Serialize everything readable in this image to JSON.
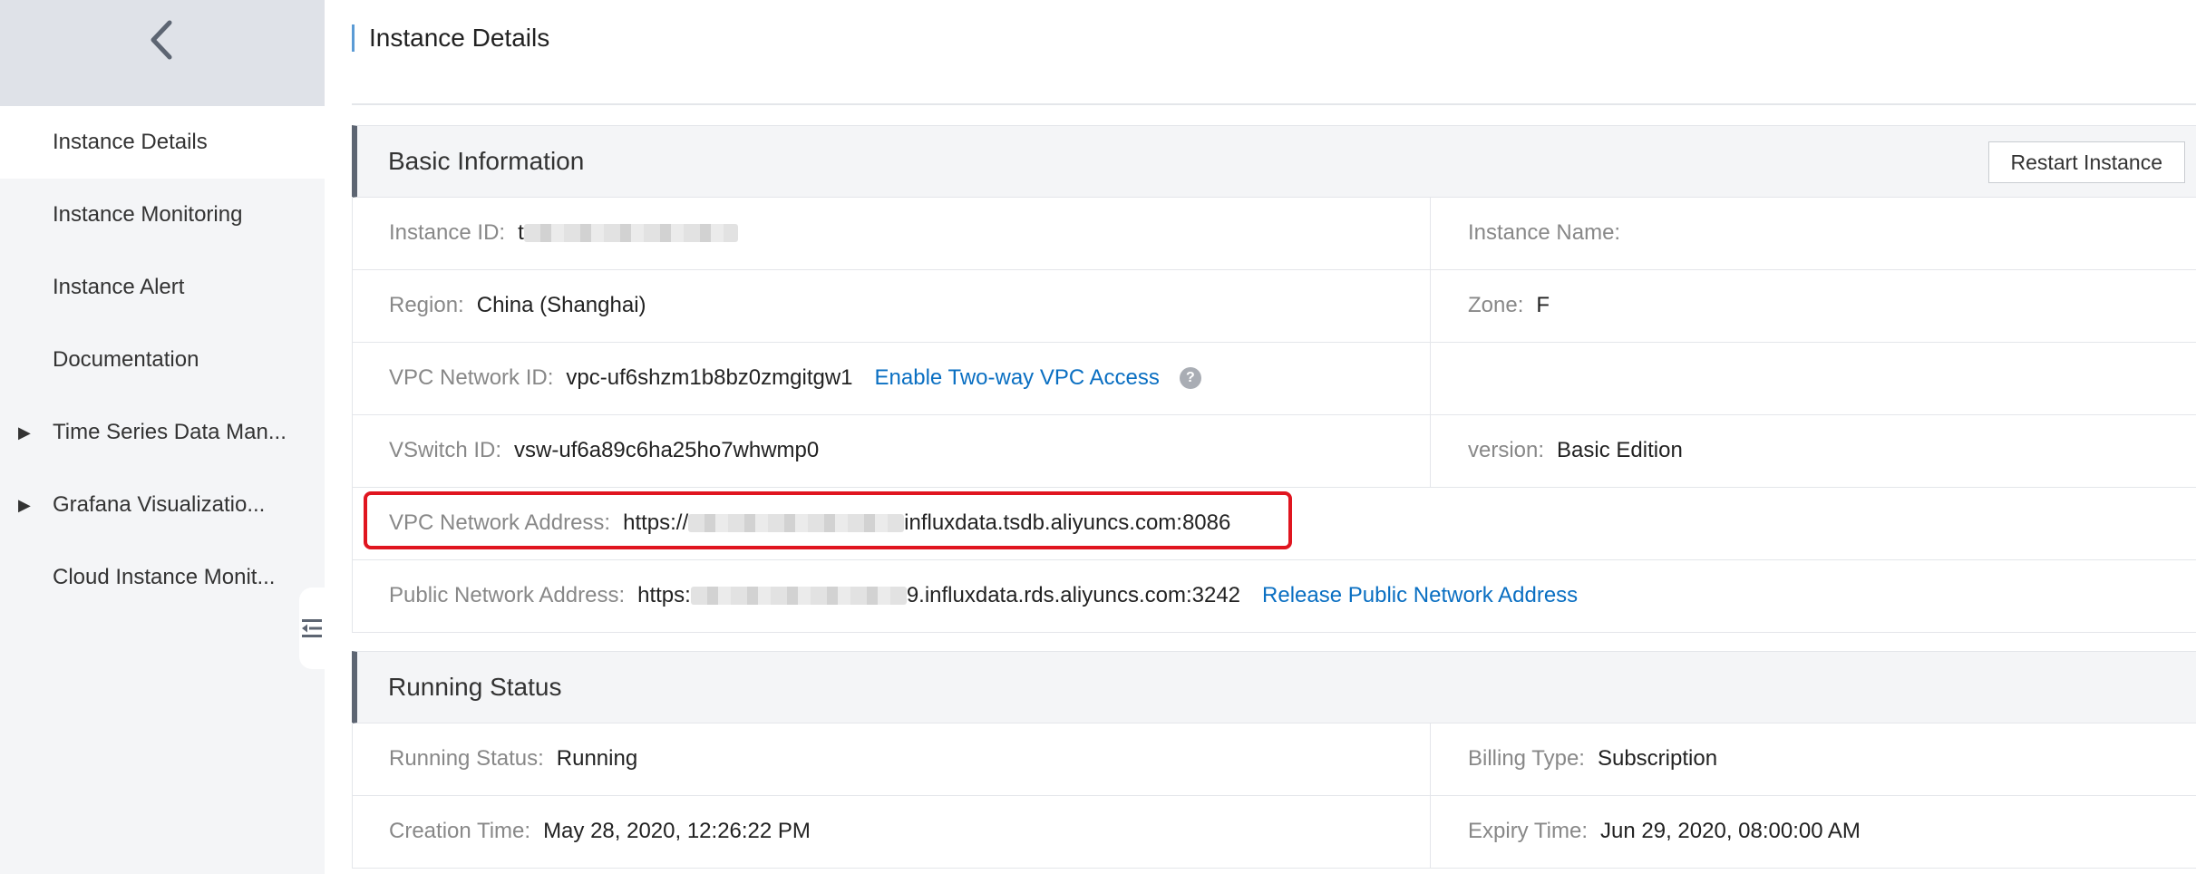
{
  "sidebar": {
    "items": [
      {
        "label": "Instance Details",
        "active": true,
        "expandable": false
      },
      {
        "label": "Instance Monitoring",
        "active": false,
        "expandable": false
      },
      {
        "label": "Instance Alert",
        "active": false,
        "expandable": false
      },
      {
        "label": "Documentation",
        "active": false,
        "expandable": false
      },
      {
        "label": "Time Series Data Man...",
        "active": false,
        "expandable": true
      },
      {
        "label": "Grafana Visualizatio...",
        "active": false,
        "expandable": true
      },
      {
        "label": "Cloud Instance Monit...",
        "active": false,
        "expandable": false
      }
    ]
  },
  "header": {
    "title": "Instance Details"
  },
  "basic_info": {
    "title": "Basic Information",
    "restart_label": "Restart Instance",
    "instance_id": {
      "label": "Instance ID:",
      "value_prefix": "t"
    },
    "instance_name": {
      "label": "Instance Name:",
      "value": ""
    },
    "region": {
      "label": "Region:",
      "value": "China (Shanghai)"
    },
    "zone": {
      "label": "Zone:",
      "value": "F"
    },
    "vpc_id": {
      "label": "VPC Network ID:",
      "value": "vpc-uf6shzm1b8bz0zmgitgw1",
      "link": "Enable Two-way VPC Access"
    },
    "vswitch_id": {
      "label": "VSwitch ID:",
      "value": "vsw-uf6a89c6ha25ho7whwmp0"
    },
    "version": {
      "label": "version:",
      "value": "Basic Edition"
    },
    "vpc_address": {
      "label": "VPC Network Address:",
      "value_start": "https://",
      "value_end": "influxdata.tsdb.aliyuncs.com:8086"
    },
    "public_address": {
      "label": "Public Network Address:",
      "value_start": "https:",
      "value_end": "9.influxdata.rds.aliyuncs.com:3242",
      "link": "Release Public Network Address"
    }
  },
  "running_status": {
    "title": "Running Status",
    "status": {
      "label": "Running Status:",
      "value": "Running"
    },
    "billing": {
      "label": "Billing Type:",
      "value": "Subscription"
    },
    "created": {
      "label": "Creation Time:",
      "value": "May 28, 2020, 12:26:22 PM"
    },
    "expiry": {
      "label": "Expiry Time:",
      "value": "Jun 29, 2020, 08:00:00 AM"
    }
  },
  "colors": {
    "accent": "#5d6572",
    "link": "#0a6fc2",
    "highlight": "#e0151f"
  }
}
